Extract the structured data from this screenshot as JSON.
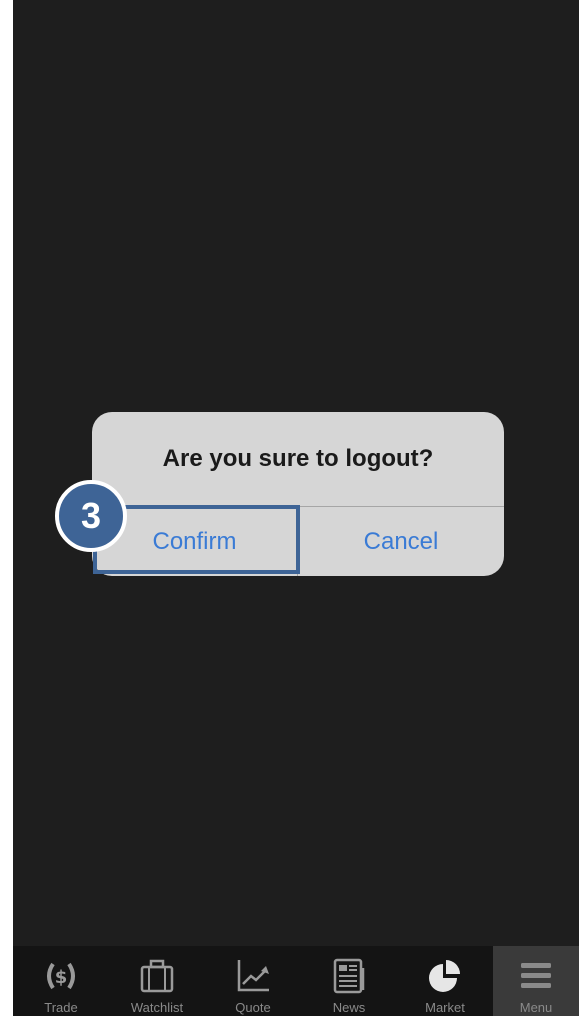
{
  "dialog": {
    "message": "Are you sure to logout?",
    "confirm_label": "Confirm",
    "cancel_label": "Cancel"
  },
  "annotation": {
    "step": "3"
  },
  "tabbar": {
    "items": [
      {
        "label": "Trade",
        "icon": "dollar-cycle-icon"
      },
      {
        "label": "Watchlist",
        "icon": "briefcase-icon"
      },
      {
        "label": "Quote",
        "icon": "line-chart-icon"
      },
      {
        "label": "News",
        "icon": "newspaper-icon"
      },
      {
        "label": "Market",
        "icon": "pie-chart-icon"
      },
      {
        "label": "Menu",
        "icon": "hamburger-menu-icon",
        "active": true
      }
    ]
  },
  "colors": {
    "background": "#1e1e1e",
    "dialog": "#d6d6d6",
    "button_text": "#3a7bd5",
    "annotation": "#3e6496",
    "tabbar": "#141414"
  }
}
